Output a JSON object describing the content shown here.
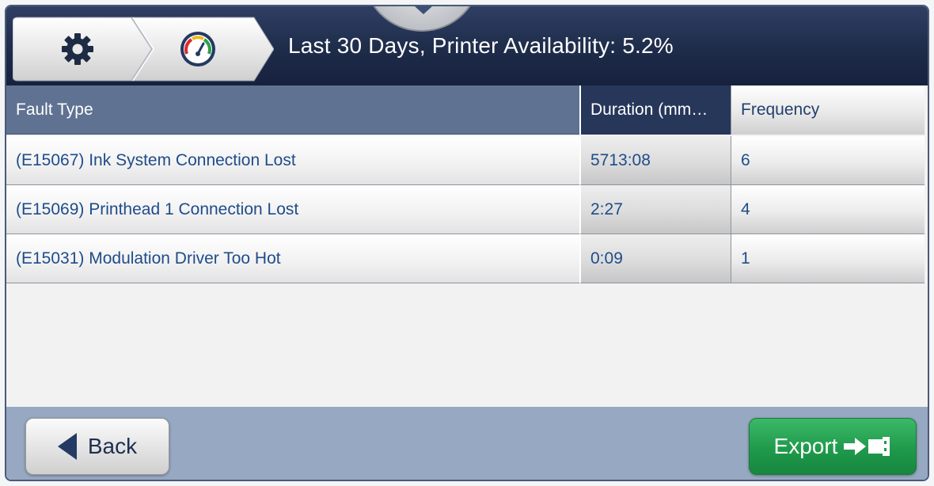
{
  "header": {
    "title": "Last 30 Days, Printer Availability: 5.2%",
    "breadcrumb": [
      {
        "icon": "gear-icon"
      },
      {
        "icon": "gauge-icon"
      }
    ],
    "dropdown_icon": "chevron-down-icon"
  },
  "table": {
    "columns": [
      "Fault Type",
      "Duration (mm…",
      "Frequency"
    ],
    "rows": [
      {
        "fault": "(E15067) Ink System Connection Lost",
        "duration": "5713:08",
        "frequency": "6"
      },
      {
        "fault": "(E15069) Printhead 1 Connection Lost",
        "duration": "2:27",
        "frequency": "4"
      },
      {
        "fault": "(E15031) Modulation Driver Too Hot",
        "duration": "0:09",
        "frequency": "1"
      }
    ]
  },
  "footer": {
    "back_label": "Back",
    "export_label": "Export"
  },
  "colors": {
    "header_bg": "#1d2a48",
    "accent_blue": "#1f4c8a",
    "export_green": "#1f9a4b",
    "footer_bg": "#97a8c2"
  }
}
